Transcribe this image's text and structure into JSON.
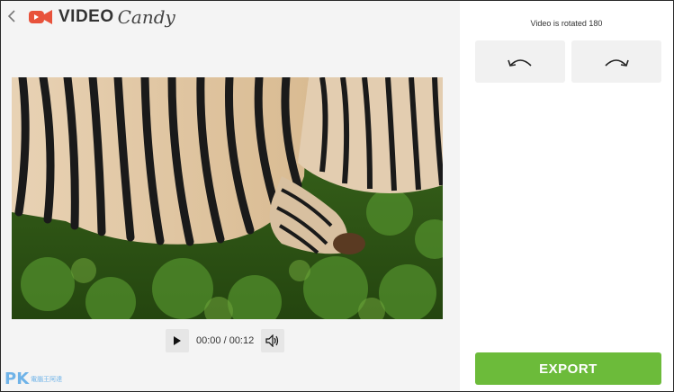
{
  "app": {
    "logo_word": "VIDEO",
    "logo_script": "Candy"
  },
  "player": {
    "time": "00:00 / 00:12"
  },
  "panel": {
    "status": "Video is rotated 180",
    "rotate_left_icon": "rotate-left-icon",
    "rotate_right_icon": "rotate-right-icon",
    "export_label": "EXPORT"
  },
  "watermark": {
    "text": "PK",
    "sub": "電腦王阿達"
  },
  "colors": {
    "accent": "#6cbb3a",
    "logo_red": "#e8523b",
    "panel_bg": "#f4f4f4"
  }
}
